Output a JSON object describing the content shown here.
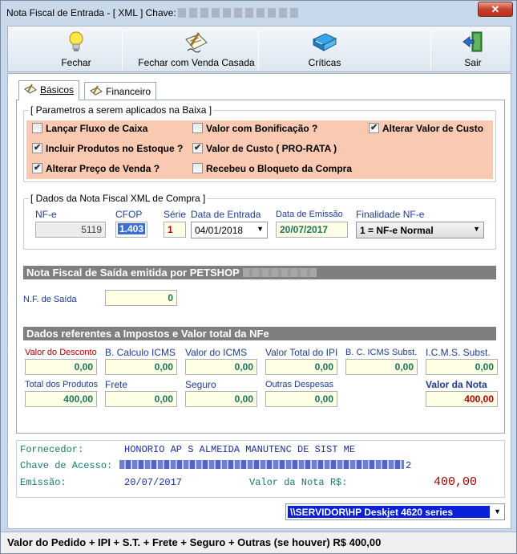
{
  "window": {
    "title": "Nota Fiscal de Entrada - [ XML ] Chave:",
    "close_label": "✕"
  },
  "toolbar": {
    "fechar": "Fechar",
    "fechar_venda": "Fechar com Venda Casada",
    "criticas": "Críticas",
    "sair": "Sair"
  },
  "tabs": {
    "basicos": "Básicos",
    "financeiro": "Financeiro"
  },
  "params": {
    "title": "[ Parametros a serem aplicados na Baixa ]",
    "items": [
      {
        "label": "Lançar Fluxo de Caixa",
        "checked": false
      },
      {
        "label": "Valor com Bonificação ?",
        "checked": false
      },
      {
        "label": "Alterar Valor de Custo",
        "checked": true
      },
      {
        "label": "Incluir Produtos no Estoque ?",
        "checked": true
      },
      {
        "label": "Valor de Custo ( PRO-RATA )",
        "checked": true
      },
      {
        "label": "Alterar Preço de Venda ?",
        "checked": true
      },
      {
        "label": "Recebeu o Bloqueto da Compra",
        "checked": false
      }
    ]
  },
  "xml": {
    "title": "[ Dados da Nota Fiscal XML de Compra ]",
    "nfe_label": "NF-e",
    "nfe_value": "5119",
    "cfop_label": "CFOP",
    "cfop_value": "1.403",
    "serie_label": "Série",
    "serie_value": "1",
    "entrada_label": "Data de Entrada",
    "entrada_value": "04/01/2018",
    "emissao_label": "Data de Emissão",
    "emissao_value": "20/07/2017",
    "finalidade_label": "Finalidade NF-e",
    "finalidade_value": "1 = NF-e Normal"
  },
  "saida": {
    "section_title": "Nota Fiscal de Saída emitida por PETSHOP",
    "nf_label": "N.F. de Saída",
    "nf_value": "0"
  },
  "impostos": {
    "section_title": "Dados referentes a Impostos e Valor total da NFe",
    "valor_desconto_label": "Valor do Desconto",
    "valor_desconto": "0,00",
    "base_icms_label": "B. Calculo ICMS",
    "base_icms": "0,00",
    "valor_icms_label": "Valor do ICMS",
    "valor_icms": "0,00",
    "valor_ipi_label": "Valor Total do IPI",
    "valor_ipi": "0,00",
    "base_icms_st_label": "B. C. ICMS Subst.",
    "base_icms_st": "0,00",
    "icms_st_label": "I.C.M.S. Subst.",
    "icms_st": "0,00",
    "total_produtos_label": "Total dos Produtos",
    "total_produtos": "400,00",
    "frete_label": "Frete",
    "frete": "0,00",
    "seguro_label": "Seguro",
    "seguro": "0,00",
    "outras_label": "Outras Despesas",
    "outras": "0,00",
    "valor_nota_label": "Valor da Nota",
    "valor_nota": "400,00"
  },
  "fornecedor": {
    "fornecedor_label": "Fornecedor:",
    "fornecedor_value": "HONORIO AP S ALMEIDA MANUTENC DE SIST ME",
    "chave_label": "Chave de Acesso:",
    "chave_tail": "2",
    "emissao_label": "Emissão:",
    "emissao_value": "20/07/2017",
    "valor_label": "Valor da Nota R$:",
    "valor_value": "400,00"
  },
  "printer": {
    "value": "\\\\SERVIDOR\\HP Deskjet 4620 series"
  },
  "status": {
    "text": "Valor do Pedido + IPI + S.T. + Frete + Seguro + Outras (se houver) R$ 400,00"
  }
}
